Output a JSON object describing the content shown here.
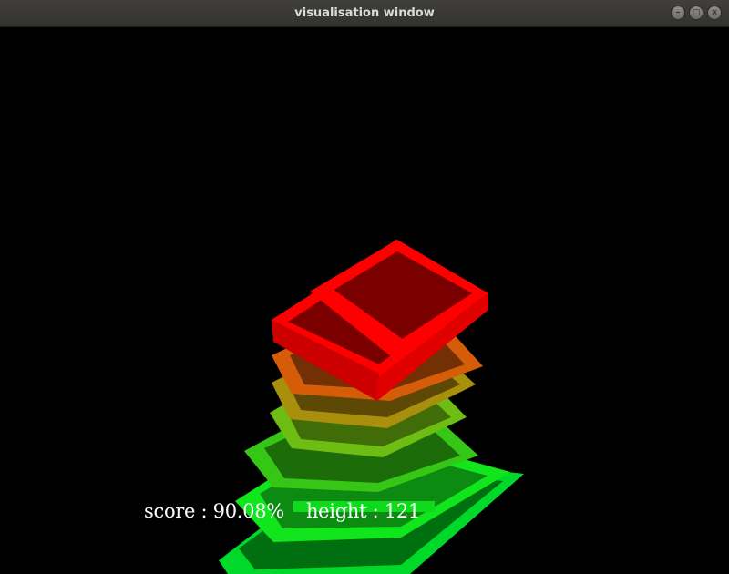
{
  "window": {
    "title": "visualisation window",
    "controls": {
      "minimize_icon": "minimize-icon",
      "maximize_icon": "maximize-icon",
      "close_icon": "close-icon"
    }
  },
  "hud": {
    "score_text": "score : 90.08%",
    "height_text": "height : 121"
  },
  "scene": {
    "background": "#000000",
    "gradient_colors": [
      "#00ff22",
      "#55cc00",
      "#aa8800",
      "#ff0000"
    ]
  }
}
